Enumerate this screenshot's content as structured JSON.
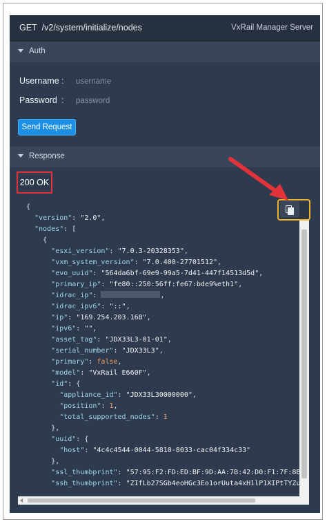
{
  "header": {
    "method": "GET",
    "path": "/v2/system/initialize/nodes",
    "server": "VxRail Manager Server"
  },
  "auth": {
    "section_label": "Auth",
    "username_label": "Username",
    "username_placeholder": "username",
    "password_label": "Password",
    "password_placeholder": "password",
    "colon": ":",
    "send_label": "Send Request"
  },
  "response": {
    "section_label": "Response",
    "status": "200 OK"
  },
  "json_text": {
    "open_brace": "{",
    "version_key": "\"version\"",
    "version_val": "\"2.0\"",
    "nodes_key": "\"nodes\"",
    "open_bracket": "[",
    "esxi_version_key": "\"esxi_version\"",
    "esxi_version_val": "\"7.0.3-20328353\"",
    "vxm_system_version_key": "\"vxm_system_version\"",
    "vxm_system_version_val": "\"7.0.400-27701512\"",
    "evo_uuid_key": "\"evo_uuid\"",
    "evo_uuid_val": "\"564da6bf-69e9-99a5-7d41-447f14513d5d\"",
    "primary_ip_key": "\"primary_ip\"",
    "primary_ip_val": "\"fe80::250:56ff:fe67:bde9%eth1\"",
    "idrac_ip_key": "\"idrac_ip\"",
    "idrac_ipv6_key": "\"idrac_ipv6\"",
    "idrac_ipv6_val": "\"::\"",
    "ip_key": "\"ip\"",
    "ip_val": "\"169.254.203.168\"",
    "ipv6_key": "\"ipv6\"",
    "ipv6_val": "\"\"",
    "asset_tag_key": "\"asset_tag\"",
    "asset_tag_val": "\"JDX33L3-01-01\"",
    "serial_number_key": "\"serial_number\"",
    "serial_number_val": "\"JDX33L3\"",
    "primary_key": "\"primary\"",
    "primary_val": "false",
    "model_key": "\"model\"",
    "model_val": "\"VxRail E660F\"",
    "id_key": "\"id\"",
    "appliance_id_key": "\"appliance_id\"",
    "appliance_id_val": "\"JDX33L30000000\"",
    "position_key": "\"position\"",
    "position_val": "1",
    "total_supported_nodes_key": "\"total_supported_nodes\"",
    "total_supported_nodes_val": "1",
    "close_brace_comma": "},",
    "uuid_key": "\"uuid\"",
    "host_key": "\"host\"",
    "host_val": "\"4c4c4544-0044-5810-8033-cac04f334c33\"",
    "ssl_thumbprint_key": "\"ssl_thumbprint\"",
    "ssl_thumbprint_val": "\"57:95:F2:FD:ED:BF:9D:AA:7B:42:D0:F1:7F:8B",
    "ssh_thumbprint_key": "\"ssh_thumbprint\"",
    "ssh_thumbprint_val": "\"ZIfLb27SGb4eoHGc3Eo1orUuta4xH1lP1XIPtTYZu"
  },
  "icons": {
    "copy": "copy-icon",
    "collapse": "triangle-down-icon",
    "annotation": "red-arrow-icon"
  },
  "colors": {
    "panel_bg": "#2e3a4d",
    "button_blue": "#1a8fe3",
    "highlight_red": "#e2323a",
    "highlight_orange": "#f2b22a"
  }
}
